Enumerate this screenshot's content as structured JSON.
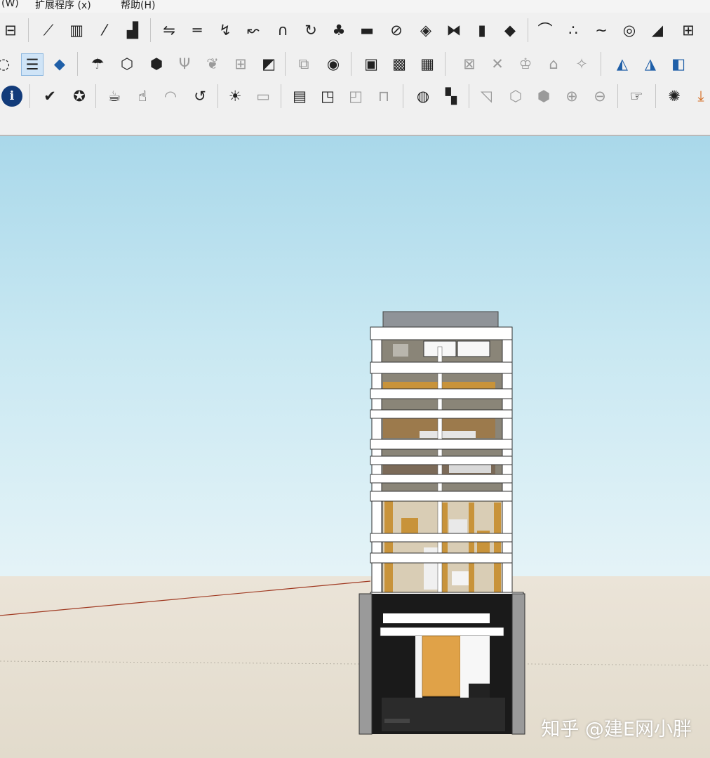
{
  "menu": {
    "window": "(W)",
    "extensions": "扩展程序 (x)",
    "help": "帮助(H)"
  },
  "toolbar_rows": [
    {
      "row": 1,
      "tools": [
        "section-icon",
        "stairs-icon",
        "column-icon",
        "line-tool-icon",
        "bar-graph-icon",
        "flip-icon",
        "align-icon",
        "curve-icon",
        "curve-arrow-icon",
        "arch-icon",
        "rotate-icon",
        "tree-icon",
        "slab-icon",
        "circle-slash-icon",
        "stack-icon",
        "split-icon",
        "cylinder-icon",
        "diamond-icon",
        "arc-icon",
        "dots-icon",
        "wave-icon",
        "spiral-icon",
        "slope-icon",
        "comb-icon"
      ]
    },
    {
      "row": 2,
      "tools": [
        "arc-partial-icon",
        "layers-icon",
        "box-blue-icon",
        "umbrella-icon",
        "cube-outline-icon",
        "cube-icon",
        "grass-icon",
        "leaf-icon",
        "grid-box-icon",
        "square-slash-icon",
        "double-box-icon",
        "eye-box-icon",
        "plan-a-icon",
        "plan-b-icon",
        "plan-c-icon",
        "view-a-icon",
        "view-b-icon",
        "view-c-icon",
        "view-d-icon",
        "view-e-icon",
        "render-a-icon",
        "render-b-icon",
        "render-c-icon"
      ]
    },
    {
      "row": 3,
      "tools": [
        "info-icon",
        "vray-icon",
        "palette-icon",
        "teapot-icon",
        "hand-icon",
        "dome-icon",
        "refresh-icon",
        "sun-icon",
        "frame-icon",
        "window-a-icon",
        "window-b-icon",
        "window-c-icon",
        "lock-icon",
        "sphere-icon",
        "grid-move-icon",
        "triangle-box-icon",
        "cube-a-icon",
        "cube-b-icon",
        "sphere-grid-icon",
        "sphere-half-icon",
        "hand-cube-icon",
        "render-light-icon",
        "arrow-down-icon"
      ]
    }
  ],
  "watermark": "知乎 @建E网小胖",
  "colors": {
    "sky_top": "#a9d8ea",
    "ground": "#e6dfd2",
    "wood": "#c8933a",
    "axis_red": "#a03a22"
  }
}
